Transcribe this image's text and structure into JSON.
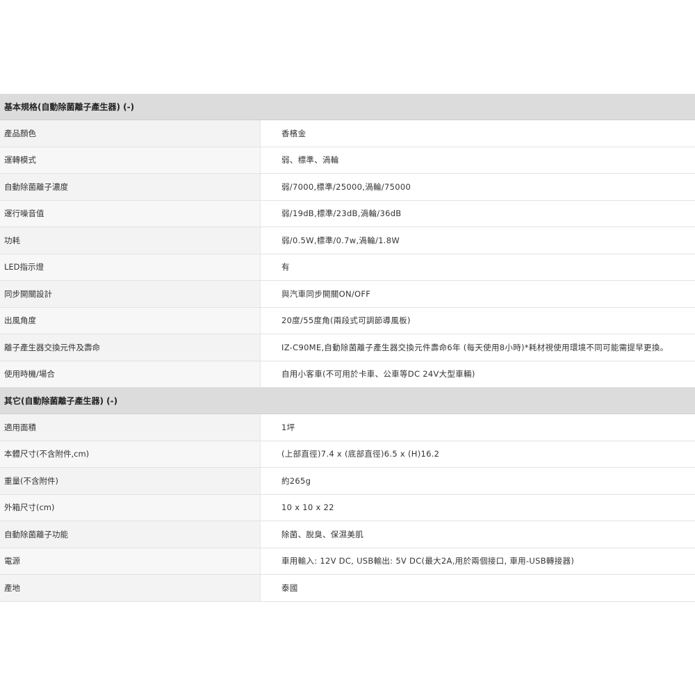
{
  "sections": [
    {
      "title": "基本規格(自動除菌離子產生器) (-)",
      "rows": [
        {
          "label": "產品顏色",
          "value": "香檳金"
        },
        {
          "label": "運轉模式",
          "value": "弱、標準、渦輪"
        },
        {
          "label": "自動除菌離子濃度",
          "value": "弱/7000,標準/25000,渦輪/75000"
        },
        {
          "label": "運行噪音值",
          "value": "弱/19dB,標準/23dB,渦輪/36dB"
        },
        {
          "label": "功耗",
          "value": "弱/0.5W,標準/0.7w,渦輪/1.8W"
        },
        {
          "label": "LED指示燈",
          "value": "有"
        },
        {
          "label": "同步開關設計",
          "value": "與汽車同步開關ON/OFF"
        },
        {
          "label": "出風角度",
          "value": "20度/55度角(兩段式可調節導風板)"
        },
        {
          "label": "離子產生器交換元件及壽命",
          "value": "IZ-C90ME,自動除菌離子產生器交換元件壽命6年 (每天使用8小時)*耗材視使用環境不同可能需提早更換。"
        },
        {
          "label": "使用時機/場合",
          "value": "自用小客車(不可用於卡車、公車等DC 24V大型車輛)"
        }
      ]
    },
    {
      "title": "其它(自動除菌離子產生器) (-)",
      "rows": [
        {
          "label": "適用面積",
          "value": "1坪"
        },
        {
          "label": "本體尺寸(不含附件,cm)",
          "value": "(上部直徑)7.4 x (底部直徑)6.5 x (H)16.2"
        },
        {
          "label": "重量(不含附件)",
          "value": "約265g"
        },
        {
          "label": "外箱尺寸(cm)",
          "value": "10 x 10 x 22"
        },
        {
          "label": "自動除菌離子功能",
          "value": "除菌、脫臭、保濕美肌"
        },
        {
          "label": "電源",
          "value": "車用輸入: 12V DC, USB輸出: 5V DC(最大2A,用於兩個接口, 車用-USB轉接器)"
        },
        {
          "label": "產地",
          "value": "泰國"
        }
      ]
    }
  ]
}
